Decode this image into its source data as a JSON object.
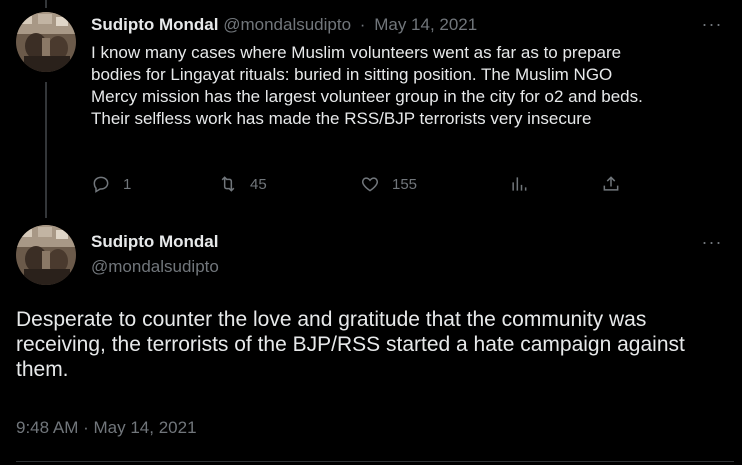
{
  "tweet1": {
    "name": "Sudipto Mondal",
    "handle": "@mondalsudipto",
    "separator": "·",
    "date": "May 14, 2021",
    "more_icon": "···",
    "body_lines": [
      "I know many cases where Muslim volunteers went as far as to prepare",
      "bodies for Lingayat rituals: buried in sitting position. The Muslim NGO",
      "Mercy mission has the largest volunteer group in the city for o2 and beds.",
      "Their selfless work has made the RSS/BJP terrorists very insecure"
    ],
    "actions": {
      "reply_count": "1",
      "retweet_count": "45",
      "like_count": "155"
    }
  },
  "tweet2": {
    "name": "Sudipto Mondal",
    "handle": "@mondalsudipto",
    "more_icon": "···",
    "body_lines": [
      "Desperate to counter the love and gratitude that the community was",
      "receiving, the terrorists of the BJP/RSS started a hate campaign against",
      "them."
    ],
    "time": "9:48 AM",
    "separator": "·",
    "date": "May 14, 2021"
  },
  "colors": {
    "background": "#000000",
    "text": "#e7e9ea",
    "secondary": "#71767b",
    "divider": "#2f3336"
  }
}
